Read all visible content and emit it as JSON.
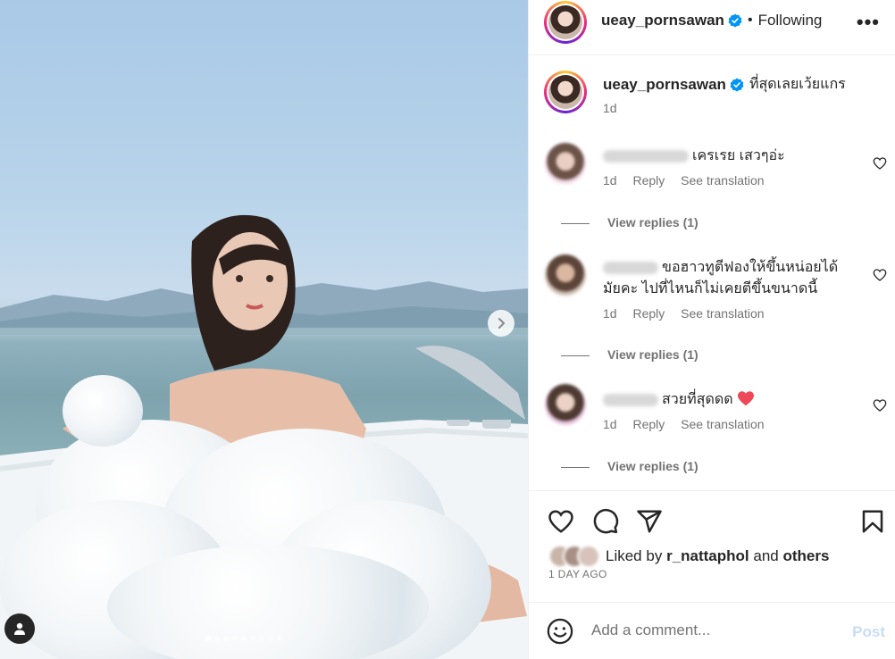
{
  "post": {
    "username": "ueay_pornsawan",
    "follow_separator": "•",
    "follow_status": "Following",
    "more_label": "•••"
  },
  "caption": {
    "username": "ueay_pornsawan",
    "text": "ที่สุดเลยเว้ยแกร",
    "time": "1d"
  },
  "comments": [
    {
      "text": "เครเรย เสวๆอ่ะ",
      "time": "1d",
      "reply_label": "Reply",
      "translate_label": "See translation",
      "view_replies": "View replies (1)"
    },
    {
      "text_line1": "ขอฮาวทูตีฟองให้ขึ้นหน่อยได้",
      "text_line2": "มัยคะ ไปที่ไหนก็ไม่เคยตีขึ้นขนาดนี้",
      "time": "1d",
      "reply_label": "Reply",
      "translate_label": "See translation",
      "view_replies": "View replies (1)"
    },
    {
      "text": "สวยที่สุดดด",
      "time": "1d",
      "reply_label": "Reply",
      "translate_label": "See translation",
      "view_replies": "View replies (1)"
    }
  ],
  "likes": {
    "prefix": "Liked by",
    "user": "r_nattaphol",
    "conjunction": "and",
    "others": "others",
    "time_ago": "1 DAY AGO"
  },
  "add_comment": {
    "placeholder": "Add a comment...",
    "post_label": "Post"
  },
  "carousel": {
    "total_slides": 9,
    "active_slide": 1
  },
  "colors": {
    "verified": "#0095f6",
    "post_disabled": "#c7dcf5",
    "heart_red": "#ed4956"
  },
  "icons": [
    "verified-badge-icon",
    "more-options-icon",
    "heart-icon",
    "comment-icon",
    "share-icon",
    "bookmark-icon",
    "emoji-icon",
    "chevron-right-icon",
    "user-icon"
  ]
}
